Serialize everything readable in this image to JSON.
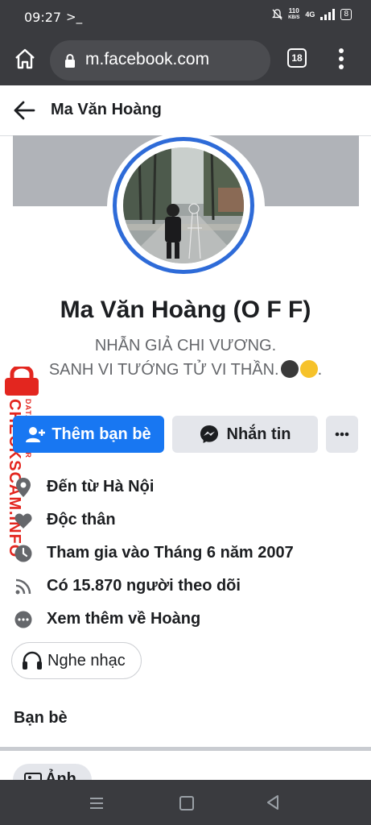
{
  "status_bar": {
    "time": "09:27",
    "terminal_glyph": ">_",
    "net_speed_value": "110",
    "net_speed_unit": "KB/S",
    "network": "4G",
    "battery": "8"
  },
  "browser": {
    "url": "m.facebook.com",
    "tab_count": "18"
  },
  "header": {
    "title": "Ma Văn Hoàng"
  },
  "profile": {
    "name": "Ma Văn Hoàng (O F F)",
    "bio_line1": "NHẪN GIẢ CHI VƯƠNG.",
    "bio_line2": "SANH VI TƯỚNG TỬ VI THẦN."
  },
  "watermark": {
    "brand": "CHECKSCAM.INFO",
    "sub": "DATA CENTER"
  },
  "actions": {
    "add_friend_label": "Thêm bạn bè",
    "message_label": "Nhắn tin"
  },
  "info_items": [
    {
      "icon": "location-pin-icon",
      "text": "Đến từ Hà Nội"
    },
    {
      "icon": "heart-icon",
      "text": "Độc thân"
    },
    {
      "icon": "clock-icon",
      "text": "Tham gia vào Tháng 6 năm 2007"
    },
    {
      "icon": "rss-icon",
      "text": "Có 15.870 người theo dõi"
    },
    {
      "icon": "more-circle-icon",
      "text": "Xem thêm về Hoàng"
    }
  ],
  "music_chip": {
    "icon": "headphones-icon",
    "label": "Nghe nhạc"
  },
  "friends_section": {
    "title": "Bạn bè"
  },
  "photos_chip": {
    "label": "Ảnh"
  },
  "colors": {
    "brand_blue": "#1877f2",
    "avatar_ring": "#2e6bd8",
    "watermark_red": "#e3261f",
    "chrome_dark": "#3a3b3f"
  }
}
